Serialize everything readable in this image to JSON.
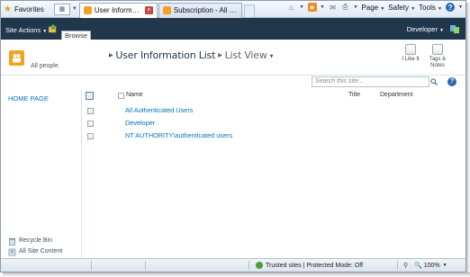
{
  "browser": {
    "favorites_label": "Favorites",
    "tabs": [
      {
        "label": "User Information List - ...",
        "active": true
      },
      {
        "label": "Subscription - All Items",
        "active": false
      }
    ],
    "commands": {
      "page": "Page",
      "safety": "Safety",
      "tools": "Tools",
      "help": "?"
    }
  },
  "ribbon": {
    "site_actions": "Site Actions",
    "browse_tab": "Browse",
    "user_name": "Developer"
  },
  "title_area": {
    "breadcrumb": [
      "User Information List",
      "List View"
    ],
    "description": "All people.",
    "like_label": "I Like It",
    "tags_label_1": "Tags &",
    "tags_label_2": "Notes"
  },
  "search": {
    "placeholder": "Search this site...",
    "help_label": "?"
  },
  "left_nav": {
    "home": "HOME PAGE",
    "recycle_bin": "Recycle Bin",
    "all_site_content": "All Site Content"
  },
  "list": {
    "columns": {
      "name": "Name",
      "title": "Title",
      "department": "Department"
    },
    "rows": [
      {
        "name": "All Authenticated Users"
      },
      {
        "name": "Developer"
      },
      {
        "name": "NT AUTHORITY\\authenticated users"
      }
    ]
  },
  "status_bar": {
    "zone": "Trusted sites | Protected Mode: Off",
    "zoom": "100%"
  },
  "colors": {
    "ribbon": "#21374c",
    "link": "#0072bc",
    "logo": "#f3a321"
  }
}
